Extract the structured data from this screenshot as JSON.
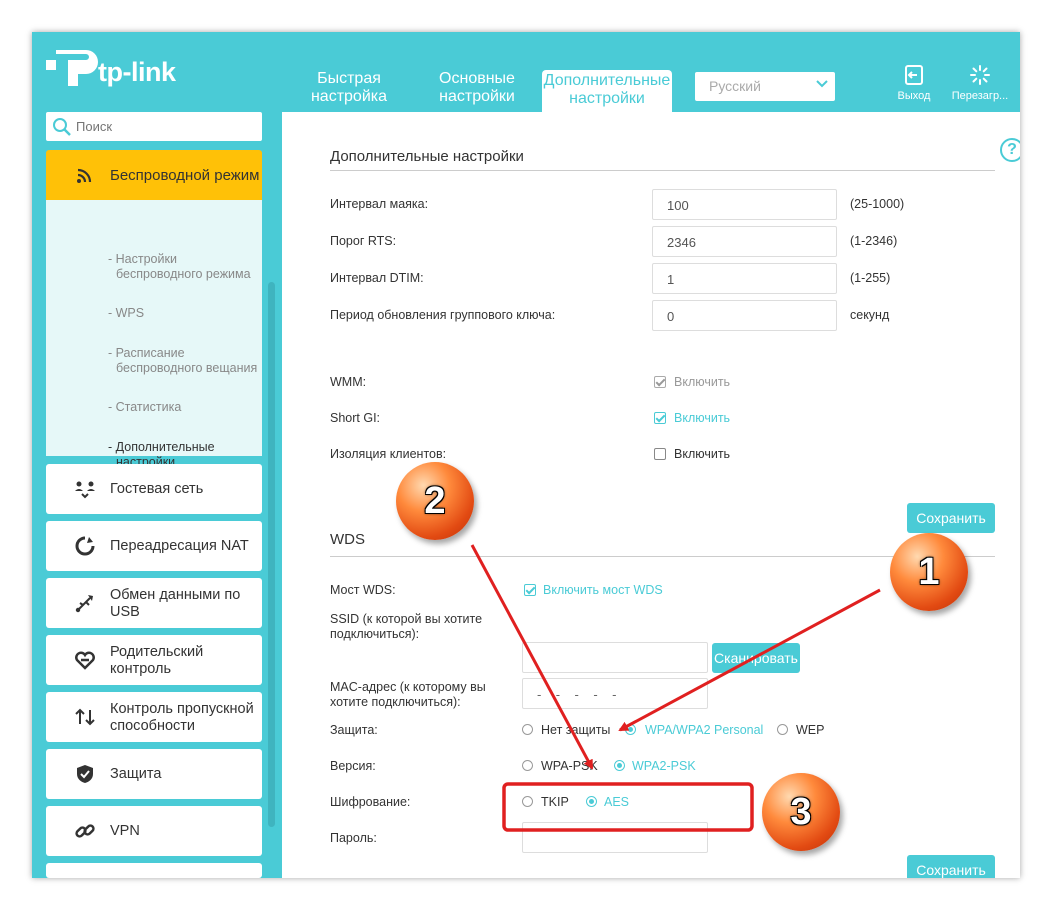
{
  "brand": {
    "logo_text": "tp-link",
    "accent": "#4acbd6",
    "highlight": "#ffc107"
  },
  "header": {
    "tabs": [
      {
        "label_l1": "Быстрая",
        "label_l2": "настройка"
      },
      {
        "label_l1": "Основные",
        "label_l2": "настройки"
      },
      {
        "label_l1": "Дополнительные",
        "label_l2": "настройки",
        "active": true
      }
    ],
    "language": "Русский",
    "logout_label": "Выход",
    "reboot_label": "Перезагр..."
  },
  "sidebar": {
    "search_placeholder": "Поиск",
    "active_item": {
      "label": "Беспроводной режим",
      "icon": "wifi-icon"
    },
    "submenu": [
      {
        "l1": "- Настройки",
        "l2": "беспроводного режима"
      },
      {
        "l1": "- WPS",
        "l2": ""
      },
      {
        "l1": "- Расписание",
        "l2": "беспроводного вещания"
      },
      {
        "l1": "- Статистика",
        "l2": ""
      },
      {
        "l1": "- Дополнительные",
        "l2": "настройки",
        "active": true
      }
    ],
    "items": [
      {
        "l1": "Гостевая сеть",
        "l2": "",
        "icon": "guest-network-icon"
      },
      {
        "l1": "Переадресация NAT",
        "l2": "",
        "icon": "nat-icon"
      },
      {
        "l1": "Обмен данными по",
        "l2": "USB",
        "icon": "usb-icon"
      },
      {
        "l1": "Родительский",
        "l2": "контроль",
        "icon": "parental-control-icon"
      },
      {
        "l1": "Контроль пропускной",
        "l2": "способности",
        "icon": "bandwidth-icon"
      },
      {
        "l1": "Защита",
        "l2": "",
        "icon": "shield-icon"
      },
      {
        "l1": "VPN",
        "l2": "",
        "icon": "vpn-icon"
      }
    ]
  },
  "advanced": {
    "title": "Дополнительные настройки",
    "beacon": {
      "label": "Интервал маяка:",
      "value": "100",
      "range": "(25-1000)"
    },
    "rts": {
      "label": "Порог RTS:",
      "value": "2346",
      "range": "(1-2346)"
    },
    "dtim": {
      "label": "Интервал DTIM:",
      "value": "1",
      "range": "(1-255)"
    },
    "gkey": {
      "label": "Период обновления группового ключа:",
      "value": "0",
      "range": "секунд"
    },
    "wmm": {
      "label": "WMM:",
      "option": "Включить",
      "checked": true
    },
    "shortgi": {
      "label": "Short GI:",
      "option": "Включить",
      "checked": true
    },
    "isolation": {
      "label": "Изоляция клиентов:",
      "option": "Включить",
      "checked": false
    },
    "save_label": "Сохранить"
  },
  "wds": {
    "title": "WDS",
    "bridge": {
      "label": "Мост WDS:",
      "option": "Включить мост WDS",
      "checked": true
    },
    "ssid": {
      "label_l1": "SSID (к которой вы хотите",
      "label_l2": "подключиться):",
      "value": "",
      "scan_label": "Сканировать"
    },
    "mac": {
      "label_l1": "MAC-адрес (к которому вы",
      "label_l2": "хотите подключиться):",
      "value": "-    -    -    -    -"
    },
    "security": {
      "label": "Защита:",
      "options": [
        "Нет защиты",
        "WPA/WPA2 Personal",
        "WEP"
      ],
      "selected": "WPA/WPA2 Personal"
    },
    "version": {
      "label": "Версия:",
      "options": [
        "WPA-PSK",
        "WPA2-PSK"
      ],
      "selected": "WPA2-PSK"
    },
    "encryption": {
      "label": "Шифрование:",
      "options": [
        "TKIP",
        "AES"
      ],
      "selected": "AES"
    },
    "password": {
      "label": "Пароль:",
      "value": ""
    },
    "save_label": "Сохранить"
  },
  "callouts": [
    "1",
    "2",
    "3"
  ]
}
